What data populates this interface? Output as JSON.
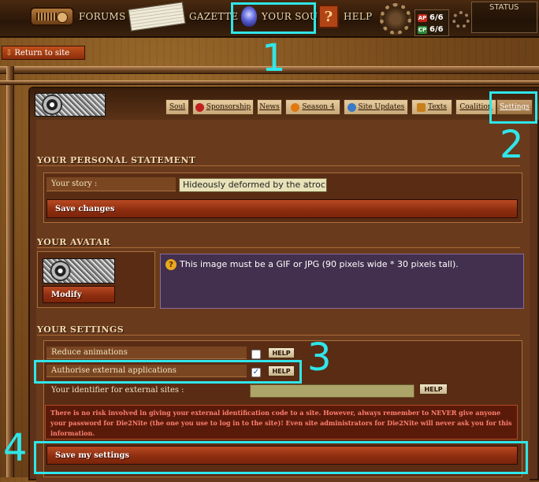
{
  "nav": {
    "forums": "FORUMS",
    "gazette": "GAZETTE",
    "soul": "YOUR SOUL",
    "help": "HELP",
    "help_glyph": "?",
    "ap_icon_label": "AP",
    "ap_value": "6/6",
    "cp_icon_label": "CP",
    "cp_value": "6/6",
    "status_label": "STATUS"
  },
  "return_to_site": "Return to site",
  "tabs": [
    {
      "label": "Soul"
    },
    {
      "label": "Sponsorship"
    },
    {
      "label": "News"
    },
    {
      "label": "Season 4"
    },
    {
      "label": "Site Updates"
    },
    {
      "label": "Texts"
    },
    {
      "label": "Coalition"
    },
    {
      "label": "Settings"
    }
  ],
  "personal": {
    "title": "YOUR PERSONAL STATEMENT",
    "story_label": "Your story :",
    "story_value": "Hideously deformed by the atroci",
    "save_label": "Save changes"
  },
  "avatar": {
    "title": "YOUR AVATAR",
    "modify_label": "Modify",
    "info_glyph": "?",
    "info_text": "This image must be a GIF or JPG (90 pixels wide * 30 pixels tall)."
  },
  "settings": {
    "title": "YOUR SETTINGS",
    "reduce_label": "Reduce animations",
    "reduce_checked": false,
    "authorise_label": "Authorise external applications",
    "authorise_checked": true,
    "identifier_label": "Your identifier for external sites :",
    "help_label": "HELP",
    "warning_text": "There is no risk involved in giving your external identification code to a site. However, always remember to NEVER give anyone your password for Die2Nite (the one you use to log in to the site)! Even site administrators for Die2Nite will never ask you for this information.",
    "save_label": "Save my settings"
  },
  "annotations": [
    "1",
    "2",
    "3",
    "4"
  ],
  "colors": {
    "annotation": "#2fe6ea",
    "button_red": "#9a3414",
    "info_bg": "#43304e"
  }
}
